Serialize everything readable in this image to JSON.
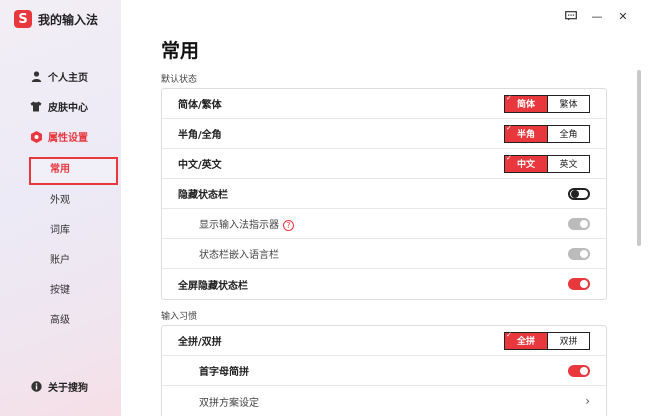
{
  "app": {
    "logo_char": "S",
    "title": "我的输入法"
  },
  "nav": {
    "items": [
      {
        "label": "个人主页"
      },
      {
        "label": "皮肤中心"
      },
      {
        "label": "属性设置"
      }
    ],
    "sub_items": [
      {
        "label": "常用"
      },
      {
        "label": "外观"
      },
      {
        "label": "词库"
      },
      {
        "label": "账户"
      },
      {
        "label": "按键"
      },
      {
        "label": "高级"
      }
    ],
    "about": "关于搜狗"
  },
  "window": {
    "feedback_icon": "chat-icon",
    "minimize": "—",
    "close": "✕"
  },
  "page": {
    "title": "常用",
    "sections": [
      {
        "title": "默认状态",
        "rows": [
          {
            "label": "简体/繁体",
            "seg": [
              "简体",
              "繁体"
            ],
            "selected": 0
          },
          {
            "label": "半角/全角",
            "seg": [
              "半角",
              "全角"
            ],
            "selected": 0
          },
          {
            "label": "中文/英文",
            "seg": [
              "中文",
              "英文"
            ],
            "selected": 0
          },
          {
            "label": "隐藏状态栏",
            "toggle": "off"
          },
          {
            "label": "显示输入法指示器",
            "toggle": "disabled",
            "help": "?"
          },
          {
            "label": "状态栏嵌入语言栏",
            "toggle": "disabled"
          },
          {
            "label": "全屏隐藏状态栏",
            "toggle": "on"
          }
        ]
      },
      {
        "title": "输入习惯",
        "rows": [
          {
            "label": "全拼/双拼",
            "seg": [
              "全拼",
              "双拼"
            ],
            "selected": 0
          },
          {
            "label": "首字母简拼",
            "toggle": "on"
          },
          {
            "label": "双拼方案设定",
            "chevron": "›"
          }
        ]
      }
    ]
  },
  "colors": {
    "accent": "#e8383d"
  }
}
